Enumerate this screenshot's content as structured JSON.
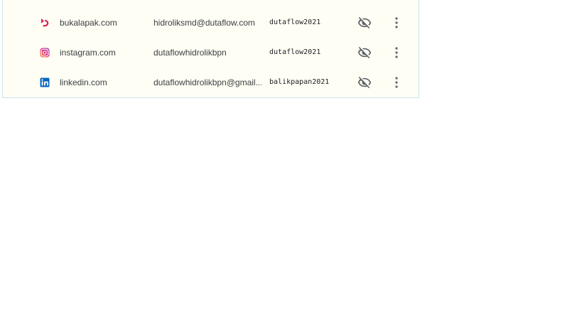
{
  "passwords": [
    {
      "site": "bukalapak.com",
      "username": "hidroliksmd@dutaflow.com",
      "password": "dutaflow2021",
      "icon": "bukalapak-icon",
      "icon_color": "#e31e52"
    },
    {
      "site": "instagram.com",
      "username": "dutaflowhidrolikbpn",
      "password": "dutaflow2021",
      "icon": "instagram-icon",
      "icon_color": "#d6249f"
    },
    {
      "site": "linkedin.com",
      "username": "dutaflowhidrolikbpn@gmail....",
      "password": "balikpapan2021",
      "icon": "linkedin-icon",
      "icon_color": "#0a66c2"
    }
  ],
  "actions": {
    "show_password_icon": "eye-off-icon",
    "more_actions_icon": "more-vert-icon"
  },
  "colors": {
    "panel_background": "#fffef4",
    "text": "#3c4043",
    "icon_gray": "#5f6368"
  }
}
